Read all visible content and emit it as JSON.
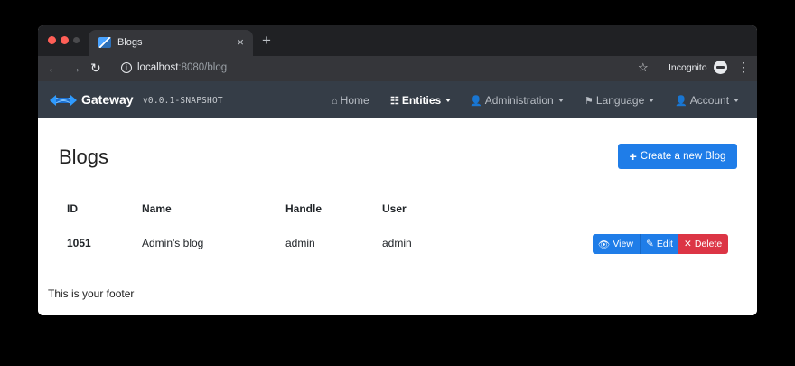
{
  "browser": {
    "tab_title": "Blogs",
    "tab_close": "×",
    "new_tab": "+",
    "url_host": "localhost",
    "url_rest": ":8080/blog",
    "mode_label": "Incognito"
  },
  "navbar": {
    "brand_name": "Gateway",
    "brand_version": "v0.0.1-SNAPSHOT",
    "items": [
      {
        "label": "Home",
        "icon": "home-icon"
      },
      {
        "label": "Entities",
        "icon": "th-list-icon"
      },
      {
        "label": "Administration",
        "icon": "user-plus-icon"
      },
      {
        "label": "Language",
        "icon": "flag-icon"
      },
      {
        "label": "Account",
        "icon": "user-icon"
      }
    ]
  },
  "page": {
    "title": "Blogs",
    "create_button": "Create a new Blog"
  },
  "table": {
    "columns": [
      "ID",
      "Name",
      "Handle",
      "User"
    ],
    "rows": [
      {
        "id": "1051",
        "name": "Admin's blog",
        "handle": "admin",
        "user": "admin"
      }
    ],
    "actions": {
      "view": "View",
      "edit": "Edit",
      "delete": "Delete"
    }
  },
  "footer": {
    "text": "This is your footer"
  },
  "colors": {
    "navbar_bg": "#353d47",
    "primary": "#1f7de8",
    "danger": "#dc3545"
  }
}
